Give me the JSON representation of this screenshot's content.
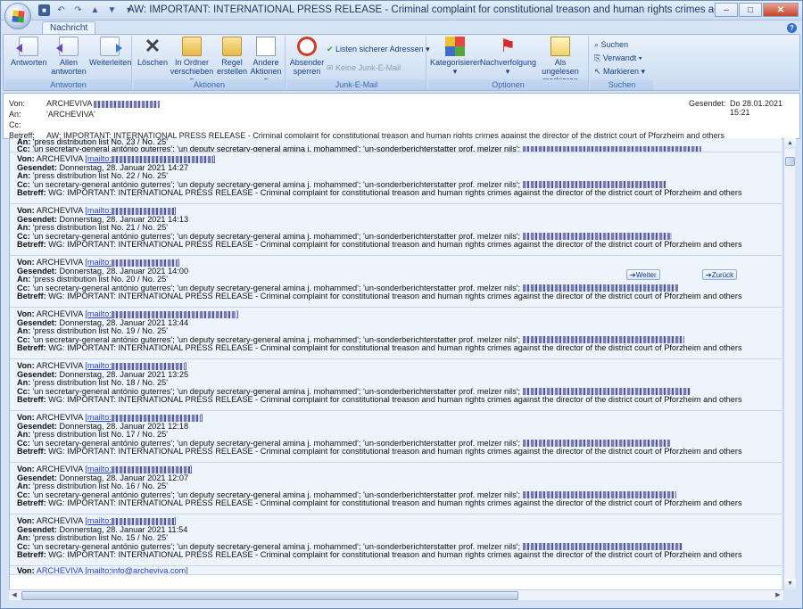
{
  "window": {
    "title": "AW: IMPORTANT: INTERNATIONAL PRESS RELEASE  - Criminal complaint for constitutional treason and human rights crimes against the director of the district court of Pforzhe...",
    "tab": "Nachricht",
    "controls": {
      "minimize": "–",
      "maximize": "□",
      "close": "✕"
    }
  },
  "ribbon": {
    "groups": {
      "antworten": "Antworten",
      "aktionen": "Aktionen",
      "junk": "Junk-E-Mail",
      "optionen": "Optionen",
      "suchen": "Suchen"
    },
    "buttons": {
      "reply": "Antworten",
      "reply_all_1": "Allen",
      "reply_all_2": "antworten",
      "forward": "Weiterleiten",
      "delete": "Löschen",
      "move_1": "In Ordner",
      "move_2": "verschieben ▾",
      "rule_1": "Regel",
      "rule_2": "erstellen",
      "other_1": "Andere",
      "other_2": "Aktionen ▾",
      "block_1": "Absender",
      "block_2": "sperren",
      "safe_list": "Listen sicherer Adressen ▾",
      "not_junk": "Keine Junk-E-Mail",
      "categorize": "Kategorisieren",
      "followup": "Nachverfolgung",
      "mark_unread_1": "Als ungelesen",
      "mark_unread_2": "markieren",
      "find": "Suchen",
      "related": "Verwandt ▾",
      "select": "Markieren ▾"
    }
  },
  "header": {
    "from_label": "Von:",
    "from": "ARCHEVIVA",
    "to_label": "An:",
    "to": "'ARCHEVIVA'",
    "cc_label": "Cc:",
    "subject_label": "Betreff:",
    "subject": "AW: IMPORTANT:  INTERNATIONAL PRESS RELEASE  -  Criminal complaint for constitutional treason and human rights crimes against the director of the district court of Pforzheim and others",
    "sent_label": "Gesendet:",
    "sent": "Do 28.01.2021 15:21"
  },
  "body": {
    "labels": {
      "from": "Von:",
      "sent": "Gesendet:",
      "to": "An:",
      "cc": "Cc:",
      "subject": "Betreff:"
    },
    "from_name": "ARCHEVIVA",
    "mailto": "[mailto:",
    "cc_text": "'un secretary-general antónio guterres'; 'un deputy secretary-general amina j. mohammed'; 'un-sonderberichterstatter prof. melzer nils';",
    "subject_text": "WG: IMPORTANT: INTERNATIONAL PRESS RELEASE - Criminal complaint for constitutional treason and human rights crimes against the director of the district court of Pforzheim and others",
    "top_partial_to": "'press distribution list No. 23 / No. 25'",
    "messages": [
      {
        "sent": "Donnerstag, 28. Januar 2021 14:27",
        "to": "'press distribution list No. 22 / No. 25'"
      },
      {
        "sent": "Donnerstag, 28. Januar 2021 14:13",
        "to": "'press distribution list No. 21 / No. 25'"
      },
      {
        "sent": "Donnerstag, 28. Januar 2021 14:00",
        "to": "'press distribution list No. 20 / No. 25'"
      },
      {
        "sent": "Donnerstag, 28. Januar 2021 13:44",
        "to": "'press distribution list No. 19 / No. 25'"
      },
      {
        "sent": "Donnerstag, 28. Januar 2021 13:25",
        "to": "'press distribution list No. 18 / No. 25'"
      },
      {
        "sent": "Donnerstag, 28. Januar 2021 12:18",
        "to": "'press distribution list No. 17 / No. 25'"
      },
      {
        "sent": "Donnerstag, 28. Januar 2021 12:07",
        "to": "'press distribution list No. 16 / No. 25'"
      },
      {
        "sent": "Donnerstag, 28. Januar 2021 11:54",
        "to": "'press distribution list No. 15 / No. 25'"
      }
    ],
    "bottom_partial": "ARCHEVIVA [mailto:info@archeviva.com]",
    "nav_next": "Weiter",
    "nav_prev": "Zurück"
  }
}
